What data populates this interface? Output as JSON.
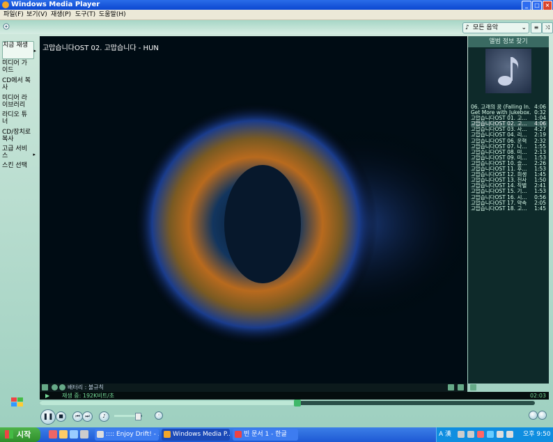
{
  "window": {
    "title": "Windows Media Player"
  },
  "menu": [
    "파일(F)",
    "보기(V)",
    "재생(P)",
    "도구(T)",
    "도움말(H)"
  ],
  "toolbar": {
    "library_selector": "모든 음악"
  },
  "nav": [
    {
      "label": "지금 재생",
      "active": true,
      "arrow": "▸"
    },
    {
      "label": "미디어 가이드"
    },
    {
      "label": "CD에서 복사"
    },
    {
      "label": "미디어 라이브러리"
    },
    {
      "label": "라디오 튜너"
    },
    {
      "label": "CD/장치로 복사"
    },
    {
      "label": "고급 서비스",
      "arrow": "▸"
    },
    {
      "label": "스킨 선택"
    }
  ],
  "now_playing": {
    "title": "고맙습니다OST 02. 고맙습니다 - HUN"
  },
  "info_panel": {
    "header": "앨범 정보 찾기"
  },
  "playlist": [
    {
      "title": "06. 고래의 꿈 (Falling In...",
      "duration": "4:06"
    },
    {
      "title": "Get More with Jukebox...",
      "duration": "0:32"
    },
    {
      "title": "고맙습니다OST 01. 고...",
      "duration": "1:04"
    },
    {
      "title": "고맙습니다OST 02. 고...",
      "duration": "4:06",
      "selected": true
    },
    {
      "title": "고맙습니다OST 03. 사...",
      "duration": "4:27"
    },
    {
      "title": "고맙습니다OST 04. 리...",
      "duration": "2:19"
    },
    {
      "title": "고맙습니다OST 06. 운혁",
      "duration": "2:32"
    },
    {
      "title": "고맙습니다OST 07. 나...",
      "duration": "1:55"
    },
    {
      "title": "고맙습니다OST 08. 미...",
      "duration": "2:13"
    },
    {
      "title": "고맙습니다OST 09. 미...",
      "duration": "1:53"
    },
    {
      "title": "고맙습니다OST 10. 슬...",
      "duration": "2:26"
    },
    {
      "title": "고맙습니다OST 11. 후...",
      "duration": "1:53"
    },
    {
      "title": "고맙습니다OST 12. 희생",
      "duration": "1:45"
    },
    {
      "title": "고맙습니다OST 13. 천사",
      "duration": "1:50"
    },
    {
      "title": "고맙습니다OST 14. 작별",
      "duration": "2:41"
    },
    {
      "title": "고맙습니다OST 15. 기...",
      "duration": "1:53"
    },
    {
      "title": "고맙습니다OST 16. 시...",
      "duration": "0:56"
    },
    {
      "title": "고맙습니다OST 17. 약속",
      "duration": "2:05"
    },
    {
      "title": "고맙습니다OST 18. 고...",
      "duration": "1:45"
    }
  ],
  "visualization": {
    "label": "배터리 : 불규칙"
  },
  "status": {
    "text": "재생 중: 192K비트/초",
    "time": "02:03"
  },
  "seek": {
    "progress": 0.52
  },
  "volume": {
    "level": 0.85
  },
  "taskbar": {
    "start": "시작",
    "tasks": [
      {
        "label": ":::: Enjoy Drift! - 크..."
      },
      {
        "label": "Windows Media P...",
        "active": true
      },
      {
        "label": "빈 문서 1 - 한글"
      }
    ],
    "tray_text": "A 漢",
    "clock": "오후 9:50"
  },
  "colors": {
    "accent": "#1e59d4",
    "panel": "#9ed0c0",
    "visual_orange": "#c8731d",
    "visual_blue": "#2a4cb0"
  },
  "icons": [
    "wmp-icon",
    "music-note-icon",
    "pause-icon",
    "stop-icon",
    "prev-icon",
    "next-icon",
    "mute-icon",
    "minimize-icon",
    "maximize-icon",
    "close-icon"
  ]
}
